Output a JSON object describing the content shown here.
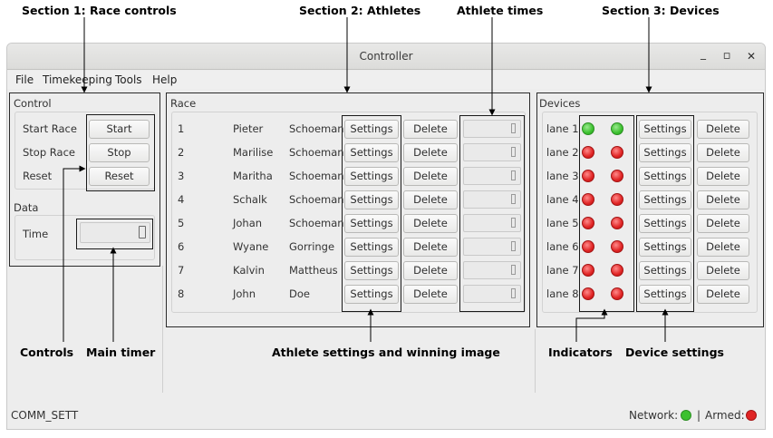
{
  "annotations": {
    "section1": "Section 1: Race controls",
    "section2": "Section 2: Athletes",
    "athlete_times": "Athlete times",
    "section3": "Section 3: Devices",
    "controls": "Controls",
    "main_timer": "Main timer",
    "athlete_settings": "Athlete settings and winning image",
    "indicators": "Indicators",
    "device_settings": "Device settings"
  },
  "window": {
    "title": "Controller",
    "minimize_glyph": "_",
    "maximize_glyph": "▫",
    "close_glyph": "✕"
  },
  "menu": [
    "File",
    "Timekeeping",
    "Tools",
    "Help"
  ],
  "control": {
    "group_label": "Control",
    "rows": [
      {
        "label": "Start Race",
        "button": "Start"
      },
      {
        "label": "Stop Race",
        "button": "Stop"
      },
      {
        "label": "Reset",
        "button": "Reset"
      }
    ]
  },
  "data_panel": {
    "group_label": "Data",
    "time_label": "Time"
  },
  "race": {
    "group_label": "Race",
    "settings_label": "Settings",
    "delete_label": "Delete",
    "athletes": [
      {
        "num": "1",
        "first": "Pieter",
        "last": "Schoeman"
      },
      {
        "num": "2",
        "first": "Marilise",
        "last": "Schoeman"
      },
      {
        "num": "3",
        "first": "Maritha",
        "last": "Schoeman"
      },
      {
        "num": "4",
        "first": "Schalk",
        "last": "Schoeman"
      },
      {
        "num": "5",
        "first": "Johan",
        "last": "Schoeman"
      },
      {
        "num": "6",
        "first": "Wyane",
        "last": "Gorringe"
      },
      {
        "num": "7",
        "first": "Kalvin",
        "last": "Mattheus"
      },
      {
        "num": "8",
        "first": "John",
        "last": "Doe"
      }
    ]
  },
  "devices": {
    "group_label": "Devices",
    "settings_label": "Settings",
    "delete_label": "Delete",
    "lanes": [
      {
        "label": "lane 1",
        "led1": "green",
        "led2": "green"
      },
      {
        "label": "lane 2",
        "led1": "red",
        "led2": "red"
      },
      {
        "label": "lane 3",
        "led1": "red",
        "led2": "red"
      },
      {
        "label": "lane 4",
        "led1": "red",
        "led2": "red"
      },
      {
        "label": "lane 5",
        "led1": "red",
        "led2": "red"
      },
      {
        "label": "lane 6",
        "led1": "red",
        "led2": "red"
      },
      {
        "label": "lane 7",
        "led1": "red",
        "led2": "red"
      },
      {
        "label": "lane 8",
        "led1": "red",
        "led2": "red"
      }
    ]
  },
  "status": {
    "left": "COMM_SETT",
    "network_label": "Network:",
    "network_state": "green",
    "separator": "|",
    "armed_label": "Armed:",
    "armed_state": "red"
  },
  "colors": {
    "led_green": "#3cc12f",
    "led_red": "#e02424",
    "highlight_border": "#1a1a1a"
  }
}
